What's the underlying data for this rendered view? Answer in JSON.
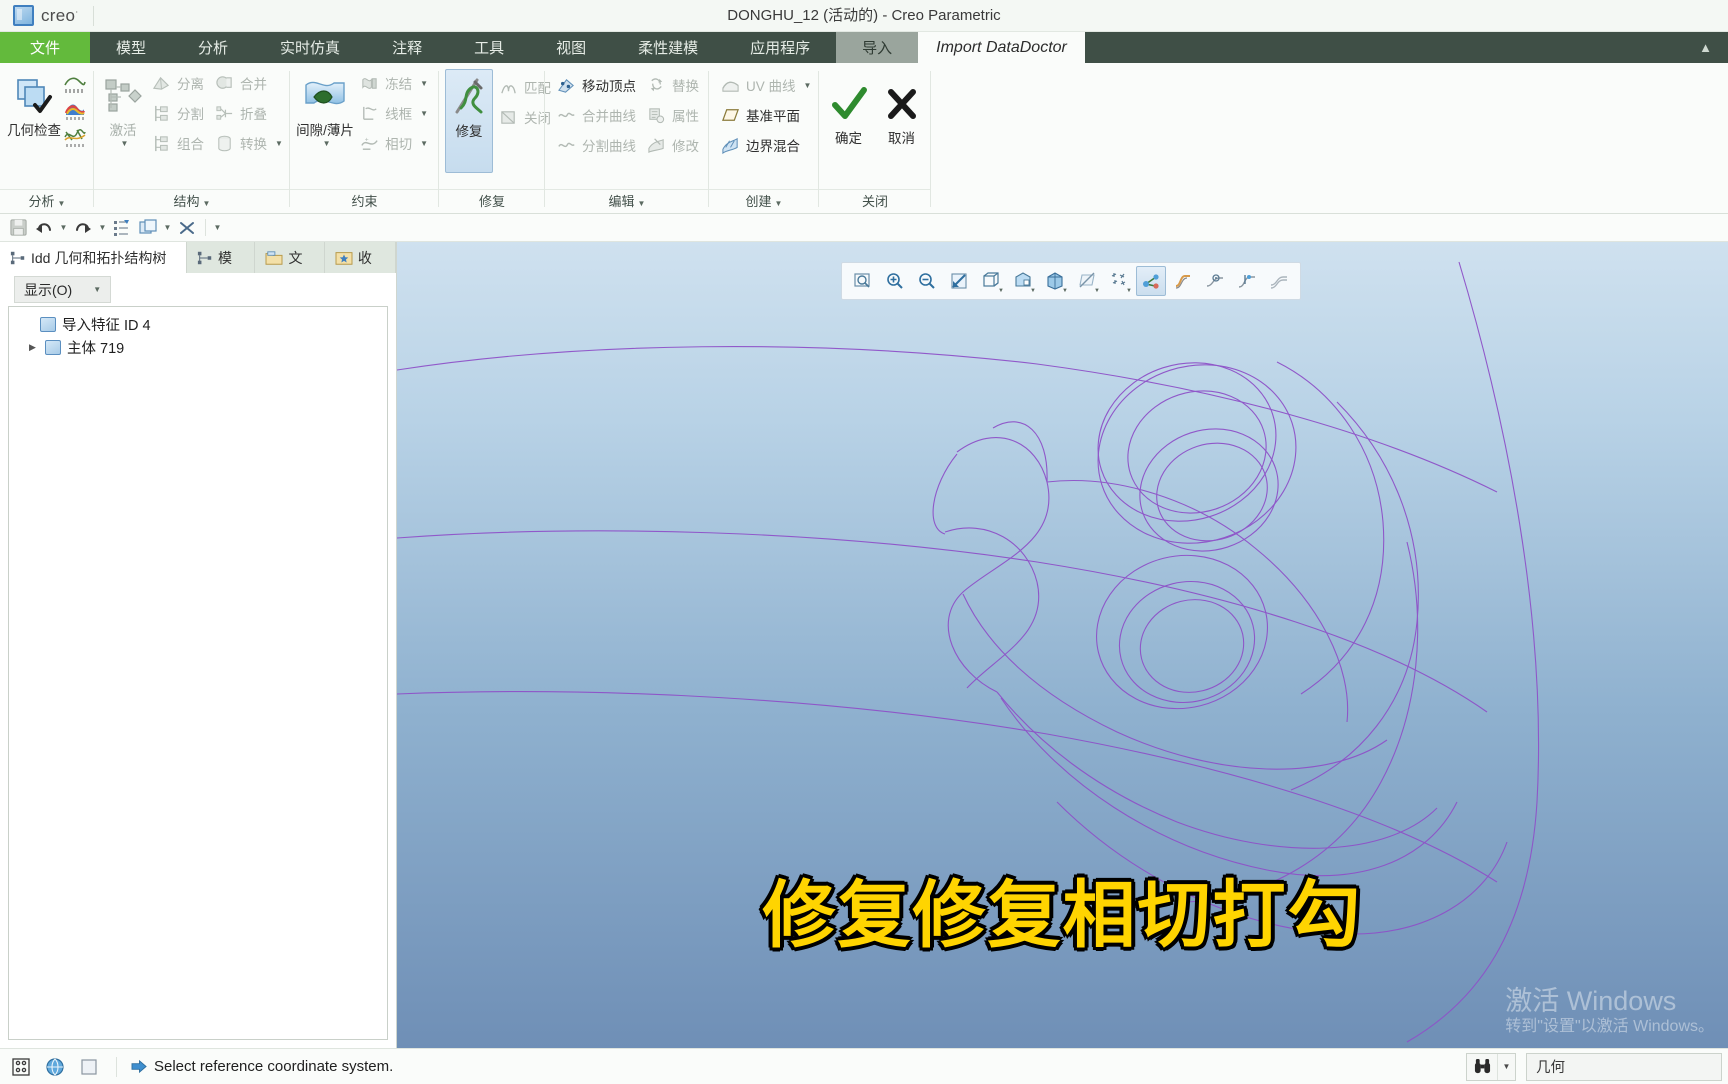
{
  "window": {
    "logo_text": "creo",
    "logo_sup": "·",
    "title": "DONGHU_12 (活动的) - Creo Parametric"
  },
  "ribbon_tabs": [
    {
      "label": "文件",
      "style": "file"
    },
    {
      "label": "模型",
      "style": "normal"
    },
    {
      "label": "分析",
      "style": "normal"
    },
    {
      "label": "实时仿真",
      "style": "normal"
    },
    {
      "label": "注释",
      "style": "normal"
    },
    {
      "label": "工具",
      "style": "normal"
    },
    {
      "label": "视图",
      "style": "normal"
    },
    {
      "label": "柔性建模",
      "style": "normal"
    },
    {
      "label": "应用程序",
      "style": "normal"
    },
    {
      "label": "导入",
      "style": "active"
    }
  ],
  "context_tab": "Import DataDoctor",
  "ribbon_groups": [
    {
      "label": "分析",
      "has_caret": true,
      "big": {
        "label": "几何检查",
        "icon": "geometry-check-icon",
        "dim": false
      },
      "stack": [
        "curvature-plot-icon",
        "color-map-icon",
        "deviation-icon"
      ]
    },
    {
      "label": "结构",
      "has_caret": true,
      "big": {
        "label": "激活",
        "icon": "activate-icon",
        "dim": true,
        "caret": true
      },
      "items": [
        {
          "label": "分离",
          "icon": "separate-icon",
          "dim": true
        },
        {
          "label": "合并",
          "icon": "merge-icon",
          "dim": true
        },
        {
          "label": "分割",
          "icon": "split-icon",
          "dim": true
        },
        {
          "label": "折叠",
          "icon": "fold-icon",
          "dim": true
        },
        {
          "label": "组合",
          "icon": "combine-icon",
          "dim": true
        },
        {
          "label": "转换",
          "icon": "convert-icon",
          "dim": true,
          "caret": true
        }
      ]
    },
    {
      "label": "约束",
      "has_caret": false,
      "big": {
        "label": "间隙/薄片",
        "icon": "gap-sliver-icon",
        "dim": false,
        "caret": true
      },
      "items": [
        {
          "label": "冻结",
          "icon": "freeze-icon",
          "dim": true,
          "caret": true
        },
        {
          "label": "线框",
          "icon": "wireframe-icon",
          "dim": true,
          "caret": true
        },
        {
          "label": "相切",
          "icon": "tangent-icon",
          "dim": true,
          "caret": true
        }
      ]
    },
    {
      "label": "修复",
      "has_caret": false,
      "big": {
        "label": "修复",
        "icon": "repair-icon",
        "dim": false,
        "selected": true
      },
      "items": [
        {
          "label": "匹配",
          "icon": "match-icon",
          "dim": true
        },
        {
          "label": "关闭",
          "icon": "close-surface-icon",
          "dim": true
        }
      ]
    },
    {
      "label": "编辑",
      "has_caret": true,
      "items": [
        {
          "label": "移动顶点",
          "icon": "move-vertex-icon",
          "dim": false
        },
        {
          "label": "替换",
          "icon": "replace-icon",
          "dim": true
        },
        {
          "label": "合并曲线",
          "icon": "merge-curve-icon",
          "dim": true
        },
        {
          "label": "属性",
          "icon": "properties-icon",
          "dim": true
        },
        {
          "label": "分割曲线",
          "icon": "split-curve-icon",
          "dim": true
        },
        {
          "label": "修改",
          "icon": "modify-icon",
          "dim": true
        }
      ]
    },
    {
      "label": "创建",
      "has_caret": true,
      "items": [
        {
          "label": "UV 曲线",
          "icon": "uv-curve-icon",
          "dim": true,
          "caret": true
        },
        {
          "label": "基准平面",
          "icon": "datum-plane-icon",
          "dim": false
        },
        {
          "label": "边界混合",
          "icon": "boundary-blend-icon",
          "dim": false
        }
      ]
    },
    {
      "label": "关闭",
      "has_caret": false,
      "ok_cancel": [
        {
          "label": "确定",
          "icon": "check-icon"
        },
        {
          "label": "取消",
          "icon": "cross-icon"
        }
      ]
    }
  ],
  "quick_access": [
    {
      "name": "save-icon",
      "caret": false
    },
    {
      "name": "undo-icon",
      "caret": true
    },
    {
      "name": "redo-icon",
      "caret": true
    },
    {
      "name": "regenerate-icon",
      "caret": false
    },
    {
      "name": "window-icon",
      "caret": true
    },
    {
      "name": "close-window-icon",
      "caret": false
    },
    {
      "name": "customize-qat-icon",
      "caret": true
    }
  ],
  "left_panel": {
    "tabs": [
      {
        "label": "Idd 几何和拓扑结构树",
        "icon": "tree-icon",
        "active": true
      },
      {
        "label": "模",
        "icon": "tree-icon",
        "active": false
      },
      {
        "label": "文",
        "icon": "folder-icon",
        "active": false
      },
      {
        "label": "收",
        "icon": "favorites-icon",
        "active": false
      }
    ],
    "show_button": "显示(O)",
    "tree": [
      {
        "label": "导入特征 ID 4",
        "indent": 0,
        "twist": false
      },
      {
        "label": "主体 719",
        "indent": 1,
        "twist": true
      }
    ]
  },
  "graphics_toolbar": [
    {
      "name": "zoom-to-fit-icon",
      "active": false,
      "dot": false
    },
    {
      "name": "zoom-in-icon",
      "active": false,
      "dot": false
    },
    {
      "name": "zoom-out-icon",
      "active": false,
      "dot": false
    },
    {
      "name": "refit-icon",
      "active": false,
      "dot": false
    },
    {
      "name": "display-wireframe-icon",
      "active": false,
      "dot": true
    },
    {
      "name": "display-shaded-icon",
      "active": false,
      "dot": true
    },
    {
      "name": "display-shaded-edges-icon",
      "active": false,
      "dot": true
    },
    {
      "name": "datum-display-off-icon",
      "active": false,
      "dot": true
    },
    {
      "name": "datum-display-icon",
      "active": false,
      "dot": true
    },
    {
      "name": "show-connections-icon",
      "active": true,
      "dot": false
    },
    {
      "name": "highlight-tangent-icon",
      "active": false,
      "dot": false
    },
    {
      "name": "analysis-surface-icon",
      "active": false,
      "dot": false
    },
    {
      "name": "show-vertices-icon",
      "active": false,
      "dot": false
    },
    {
      "name": "shade-quilt-icon",
      "active": false,
      "dot": false
    }
  ],
  "subtitle": "修复修复相切打勾",
  "watermark": {
    "line1": "激活 Windows",
    "line2": "转到\"设置\"以激活 Windows。"
  },
  "status_bar": {
    "icons": [
      "tree-filters-icon",
      "globe-icon",
      "blank-icon"
    ],
    "message": "Select reference coordinate system.",
    "find_icon": "binoculars-icon",
    "field_value": "几何"
  },
  "colors": {
    "file_tab": "#63ba3c",
    "tabbar": "#3f4f46",
    "subtitle_fill": "#ffd400",
    "subtitle_stroke": "#000000",
    "model_curves": "#8e52c8"
  }
}
